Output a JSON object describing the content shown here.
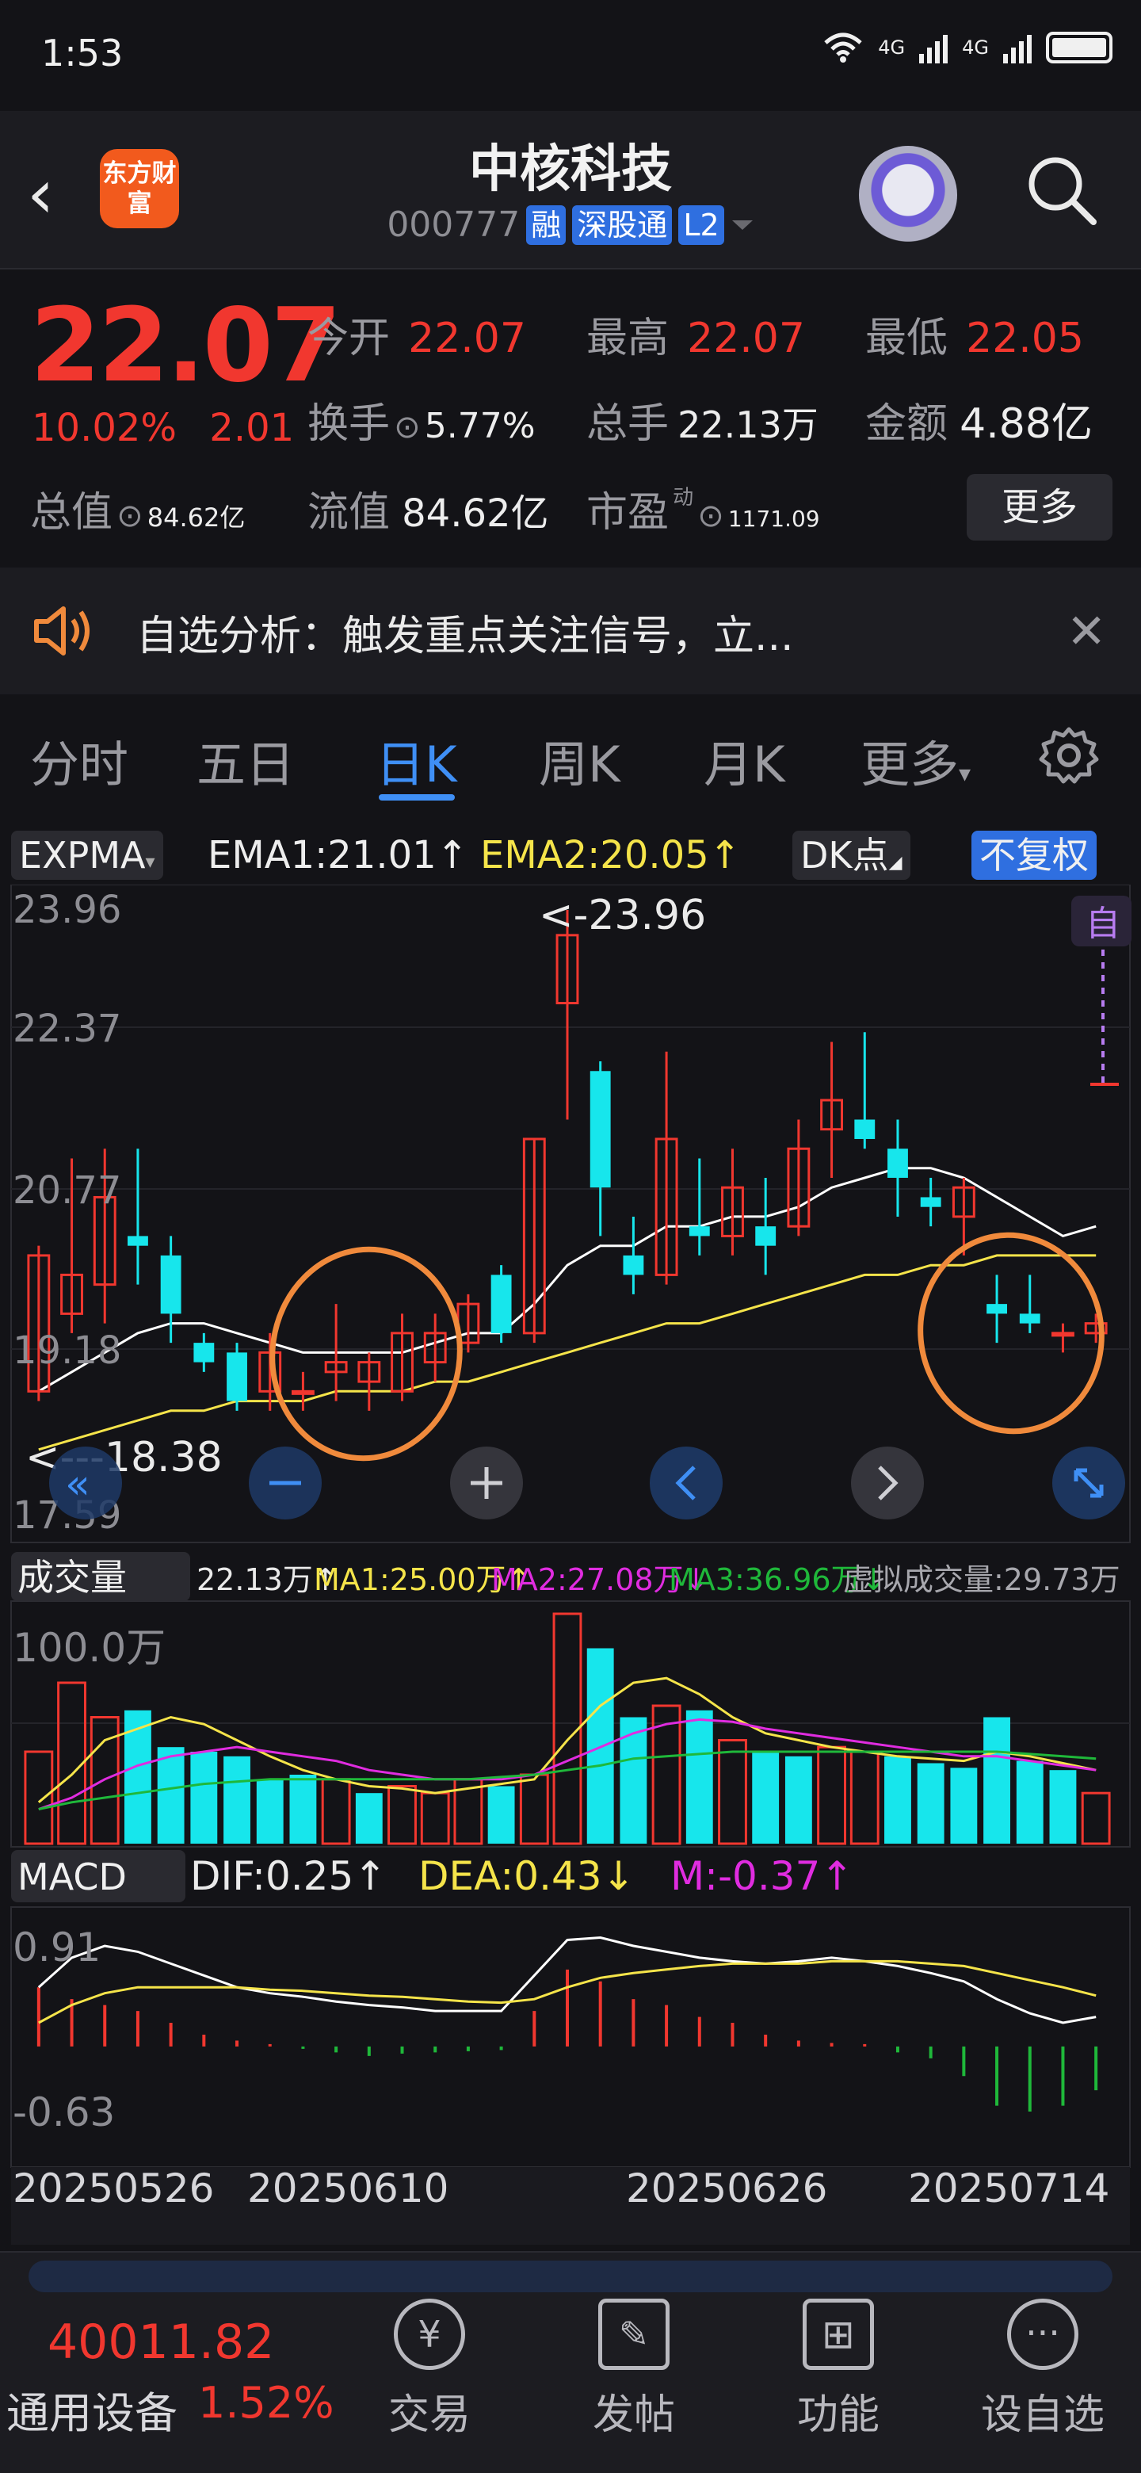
{
  "status": {
    "time": "1:53",
    "net1": "4G",
    "net2": "4G"
  },
  "header": {
    "app_logo_text": "东方财富",
    "stock_name": "中核科技",
    "code": "000777",
    "tags": [
      "融",
      "深股通",
      "L2"
    ]
  },
  "quote": {
    "price": "22.07",
    "change_pct": "10.02%",
    "change_abs": "2.01",
    "open_label": "今开",
    "open": "22.07",
    "high_label": "最高",
    "high": "22.07",
    "low_label": "最低",
    "low": "22.05",
    "turnover_label": "换手",
    "turnover": "5.77%",
    "volume_label": "总手",
    "volume": "22.13万",
    "amount_label": "金额",
    "amount": "4.88亿",
    "mktcap_label": "总值",
    "mktcap": "84.62亿",
    "float_label": "流值",
    "float": "84.62亿",
    "pe_label": "市盈",
    "pe_sup": "动",
    "pe": "1171.09",
    "more_label": "更多"
  },
  "notice": {
    "text": "自选分析：触发重点关注信号，立..."
  },
  "tabs": [
    "分时",
    "五日",
    "日K",
    "周K",
    "月K",
    "更多"
  ],
  "kline": {
    "indicator": "EXPMA",
    "ema1": "EMA1:21.01↑",
    "ema2": "EMA2:20.05↑",
    "dk_label": "DK点",
    "adjust_label": "不复权",
    "self_label": "自",
    "max_marker": "<-23.96",
    "min_marker": "<---18.38",
    "y_labels": [
      "23.96",
      "22.37",
      "20.77",
      "19.18",
      "17.59"
    ]
  },
  "volume": {
    "label": "成交量",
    "total": "22.13万↑",
    "ma1": "MA1:25.00万↑",
    "ma2": "MA2:27.08万↓",
    "ma3": "MA3:36.96万↓",
    "virtual": "虚拟成交量:29.73万",
    "y_label": "100.0万"
  },
  "macd": {
    "label": "MACD",
    "dif": "DIF:0.25↑",
    "dea": "DEA:0.43↓",
    "m": "M:-0.37↑",
    "y_top": "0.91",
    "y_bottom": "-0.63"
  },
  "x_labels": [
    "20250526",
    "20250610",
    "20250626",
    "20250714"
  ],
  "bottom": {
    "index_value": "40011.82",
    "index_name": "通用设备",
    "index_pct": "1.52%",
    "nav": [
      "交易",
      "发帖",
      "功能",
      "设自选"
    ]
  },
  "colors": {
    "up": "#f1372f",
    "down": "#17e6ec",
    "ema1": "#ffffff",
    "ema2": "#f5e44a",
    "accent": "#3f8ff5",
    "annotation": "#f08a3c"
  },
  "chart_data": {
    "type": "candlestick",
    "ylim": [
      17.59,
      23.96
    ],
    "candles": [
      {
        "o": 19.0,
        "c": 20.4,
        "h": 20.5,
        "l": 18.9
      },
      {
        "o": 19.8,
        "c": 20.2,
        "h": 21.4,
        "l": 19.6
      },
      {
        "o": 20.1,
        "c": 21.0,
        "h": 21.5,
        "l": 19.7
      },
      {
        "o": 20.6,
        "c": 20.5,
        "h": 21.5,
        "l": 20.1
      },
      {
        "o": 20.4,
        "c": 19.8,
        "h": 20.6,
        "l": 19.5
      },
      {
        "o": 19.5,
        "c": 19.3,
        "h": 19.6,
        "l": 19.2
      },
      {
        "o": 19.4,
        "c": 18.9,
        "h": 19.5,
        "l": 18.8
      },
      {
        "o": 19.0,
        "c": 19.4,
        "h": 19.6,
        "l": 18.8
      },
      {
        "o": 19.0,
        "c": 19.0,
        "h": 19.2,
        "l": 18.8
      },
      {
        "o": 19.2,
        "c": 19.3,
        "h": 19.9,
        "l": 18.9
      },
      {
        "o": 19.1,
        "c": 19.3,
        "h": 19.4,
        "l": 18.8
      },
      {
        "o": 19.0,
        "c": 19.6,
        "h": 19.8,
        "l": 18.9
      },
      {
        "o": 19.3,
        "c": 19.6,
        "h": 19.8,
        "l": 19.1
      },
      {
        "o": 19.5,
        "c": 19.9,
        "h": 20.0,
        "l": 19.4
      },
      {
        "o": 20.2,
        "c": 19.6,
        "h": 20.3,
        "l": 19.5
      },
      {
        "o": 19.6,
        "c": 21.6,
        "h": 21.6,
        "l": 19.5
      },
      {
        "o": 23.0,
        "c": 23.7,
        "h": 23.96,
        "l": 21.8
      },
      {
        "o": 22.3,
        "c": 21.1,
        "h": 22.4,
        "l": 20.6
      },
      {
        "o": 20.4,
        "c": 20.2,
        "h": 20.8,
        "l": 20.0
      },
      {
        "o": 20.2,
        "c": 21.6,
        "h": 22.5,
        "l": 20.1
      },
      {
        "o": 20.7,
        "c": 20.6,
        "h": 21.4,
        "l": 20.4
      },
      {
        "o": 20.6,
        "c": 21.1,
        "h": 21.5,
        "l": 20.4
      },
      {
        "o": 20.7,
        "c": 20.5,
        "h": 21.2,
        "l": 20.2
      },
      {
        "o": 20.7,
        "c": 21.5,
        "h": 21.8,
        "l": 20.6
      },
      {
        "o": 21.7,
        "c": 22.0,
        "h": 22.6,
        "l": 21.2
      },
      {
        "o": 21.8,
        "c": 21.6,
        "h": 22.7,
        "l": 21.5
      },
      {
        "o": 21.5,
        "c": 21.2,
        "h": 21.8,
        "l": 20.8
      },
      {
        "o": 21.0,
        "c": 20.9,
        "h": 21.2,
        "l": 20.7
      },
      {
        "o": 20.8,
        "c": 21.1,
        "h": 21.2,
        "l": 20.4
      },
      {
        "o": 19.9,
        "c": 19.8,
        "h": 20.2,
        "l": 19.5
      },
      {
        "o": 19.8,
        "c": 19.7,
        "h": 20.2,
        "l": 19.6
      },
      {
        "o": 19.6,
        "c": 19.6,
        "h": 19.7,
        "l": 19.4
      },
      {
        "o": 19.6,
        "c": 19.7,
        "h": 19.8,
        "l": 19.5
      }
    ],
    "ema1": [
      19.0,
      19.2,
      19.4,
      19.6,
      19.7,
      19.7,
      19.6,
      19.5,
      19.4,
      19.4,
      19.4,
      19.4,
      19.5,
      19.6,
      19.6,
      19.9,
      20.3,
      20.5,
      20.5,
      20.7,
      20.7,
      20.8,
      20.8,
      20.9,
      21.1,
      21.2,
      21.3,
      21.3,
      21.2,
      21.0,
      20.8,
      20.6,
      20.7
    ],
    "ema2": [
      18.4,
      18.5,
      18.6,
      18.7,
      18.8,
      18.8,
      18.9,
      18.9,
      18.9,
      19.0,
      19.0,
      19.0,
      19.1,
      19.1,
      19.2,
      19.3,
      19.4,
      19.5,
      19.6,
      19.7,
      19.7,
      19.8,
      19.9,
      20.0,
      20.1,
      20.2,
      20.2,
      20.3,
      20.3,
      20.4,
      20.4,
      20.4,
      20.4
    ],
    "volume": [
      40,
      70,
      55,
      58,
      42,
      40,
      38,
      28,
      30,
      28,
      22,
      25,
      22,
      28,
      25,
      30,
      100,
      85,
      55,
      60,
      58,
      45,
      40,
      38,
      42,
      40,
      38,
      35,
      33,
      55,
      36,
      32,
      22
    ],
    "volume_up": [
      1,
      1,
      1,
      0,
      0,
      0,
      0,
      0,
      0,
      1,
      0,
      1,
      1,
      1,
      0,
      1,
      1,
      0,
      0,
      1,
      0,
      1,
      0,
      0,
      1,
      1,
      0,
      0,
      0,
      0,
      0,
      0,
      1
    ],
    "vol_ma1": [
      18,
      30,
      45,
      50,
      55,
      52,
      45,
      38,
      32,
      28,
      25,
      24,
      22,
      24,
      26,
      28,
      45,
      60,
      70,
      72,
      65,
      55,
      48,
      45,
      42,
      40,
      38,
      37,
      36,
      40,
      38,
      35,
      32
    ],
    "vol_ma2": [
      15,
      20,
      28,
      34,
      38,
      40,
      42,
      40,
      38,
      36,
      32,
      30,
      28,
      28,
      28,
      30,
      36,
      42,
      48,
      52,
      54,
      53,
      50,
      48,
      46,
      44,
      42,
      40,
      38,
      38,
      36,
      34,
      32
    ],
    "vol_ma3": [
      15,
      18,
      20,
      22,
      24,
      26,
      27,
      28,
      28,
      28,
      28,
      28,
      28,
      28,
      29,
      30,
      32,
      34,
      37,
      38,
      39,
      40,
      40,
      40,
      40,
      40,
      40,
      40,
      40,
      40,
      39,
      38,
      37
    ],
    "macd_m": [
      0.5,
      0.4,
      0.35,
      0.3,
      0.2,
      0.1,
      0.05,
      0.02,
      -0.02,
      -0.05,
      -0.08,
      -0.06,
      -0.05,
      -0.04,
      -0.03,
      0.3,
      0.65,
      0.55,
      0.4,
      0.35,
      0.25,
      0.2,
      0.1,
      0.05,
      0.03,
      0.02,
      -0.05,
      -0.1,
      -0.25,
      -0.5,
      -0.55,
      -0.5,
      -0.37
    ],
    "dif": [
      0.5,
      0.75,
      0.85,
      0.8,
      0.7,
      0.6,
      0.5,
      0.45,
      0.42,
      0.38,
      0.35,
      0.33,
      0.3,
      0.3,
      0.3,
      0.6,
      0.9,
      0.92,
      0.85,
      0.8,
      0.75,
      0.72,
      0.7,
      0.72,
      0.75,
      0.72,
      0.68,
      0.62,
      0.55,
      0.4,
      0.28,
      0.2,
      0.25
    ],
    "dea": [
      0.2,
      0.35,
      0.45,
      0.5,
      0.5,
      0.5,
      0.5,
      0.48,
      0.47,
      0.45,
      0.43,
      0.42,
      0.4,
      0.38,
      0.37,
      0.4,
      0.5,
      0.58,
      0.62,
      0.65,
      0.68,
      0.7,
      0.7,
      0.7,
      0.72,
      0.72,
      0.72,
      0.7,
      0.68,
      0.62,
      0.56,
      0.5,
      0.43
    ],
    "x_ticks": [
      "20250526",
      "20250610",
      "20250626",
      "20250714"
    ]
  }
}
